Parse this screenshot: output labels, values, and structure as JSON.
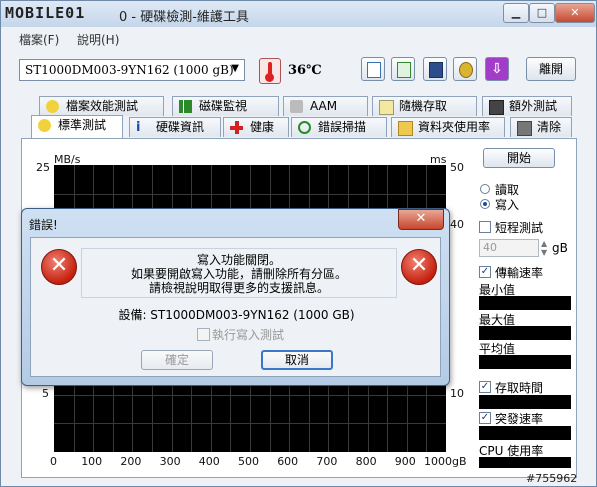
{
  "window": {
    "logo_text": "MOBILE01",
    "title": "0 - 硬碟檢測-維護工具",
    "controls": {
      "minimize": "▁",
      "maximize": "□",
      "close": "✕"
    }
  },
  "menu": {
    "items": [
      "檔案(F)",
      "說明(H)"
    ]
  },
  "toolbar": {
    "drive": "ST1000DM003-9YN162 (1000 gB)",
    "temperature": "36℃",
    "exit_label": "離開",
    "icons": [
      "copy-text-icon",
      "copy-screen-icon",
      "save-icon",
      "options-icon",
      "download-icon"
    ]
  },
  "tabs": {
    "row1": [
      "檔案效能測試",
      "磁碟監視",
      "AAM",
      "隨機存取",
      "額外測試"
    ],
    "row2": [
      "標準測試",
      "硬碟資訊",
      "健康",
      "錯誤掃描",
      "資料夾使用率",
      "清除"
    ]
  },
  "chart_data": {
    "type": "line",
    "ylabel_left": "MB/s",
    "ylabel_right": "ms",
    "y_left_ticks_visible": [
      "25",
      "5"
    ],
    "y_right_ticks_visible": [
      "50",
      "40",
      "10"
    ],
    "x_ticks": [
      "0",
      "100",
      "200",
      "300",
      "400",
      "500",
      "600",
      "700",
      "800",
      "900",
      "1000gB"
    ],
    "series": []
  },
  "right_panel": {
    "start_button": "開始",
    "read_label": "讀取",
    "write_label": "寫入",
    "mode_selected": "write",
    "short_test_label": "短程測試",
    "short_test_value": "40",
    "short_test_unit": "gB",
    "transfer_rate_label": "傳輸速率",
    "min_label": "最小值",
    "max_label": "最大值",
    "avg_label": "平均值",
    "access_time_label": "存取時間",
    "burst_rate_label": "突發速率",
    "cpu_usage_label": "CPU 使用率"
  },
  "dialog": {
    "title": "錯誤!",
    "close_glyph": "✕",
    "message_lines": [
      "寫入功能關閉。",
      "如果要開啟寫入功能，請刪除所有分區。",
      "請檢視說明取得更多的支援訊息。"
    ],
    "device_line": "設備: ST1000DM003-9YN162 (1000 GB)",
    "checkbox_label": "執行寫入測試",
    "ok_label": "確定",
    "cancel_label": "取消",
    "error_glyph": "✕"
  },
  "watermark": "#755962",
  "colors": {
    "accent": "#3a77c8",
    "error": "#c5200f",
    "chart_bg": "#000000"
  }
}
